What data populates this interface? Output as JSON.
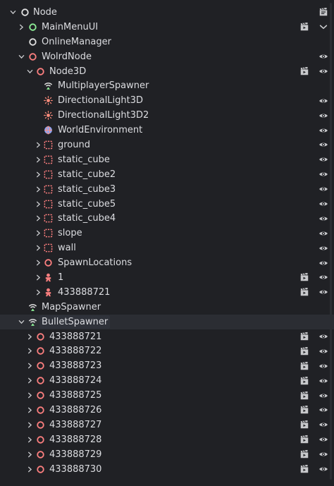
{
  "nodes": [
    {
      "label": "Node",
      "depth": 0,
      "arrow": "down",
      "icon": "white-circle-icon",
      "right": [
        "script-icon"
      ]
    },
    {
      "label": "MainMenuUI",
      "depth": 1,
      "arrow": "right",
      "icon": "green-circle-icon",
      "right": [
        "scene-icon",
        "visibility-toggle-icon"
      ]
    },
    {
      "label": "OnlineManager",
      "depth": 1,
      "arrow": "none",
      "icon": "white-circle-icon",
      "right": []
    },
    {
      "label": "WolrdNode",
      "depth": 1,
      "arrow": "down",
      "icon": "red-circle-icon",
      "right": [
        "eye-icon"
      ]
    },
    {
      "label": "Node3D",
      "depth": 2,
      "arrow": "down",
      "icon": "red-circle-icon",
      "right": [
        "scene-icon",
        "eye-icon"
      ]
    },
    {
      "label": "MultiplayerSpawner",
      "depth": 3,
      "arrow": "none",
      "icon": "spawner-icon",
      "right": []
    },
    {
      "label": "DirectionalLight3D",
      "depth": 3,
      "arrow": "none",
      "icon": "sun-icon",
      "right": [
        "eye-icon"
      ]
    },
    {
      "label": "DirectionalLight3D2",
      "depth": 3,
      "arrow": "none",
      "icon": "sun-icon",
      "right": [
        "eye-icon"
      ]
    },
    {
      "label": "WorldEnvironment",
      "depth": 3,
      "arrow": "none",
      "icon": "globe-icon",
      "right": [
        "eye-icon"
      ]
    },
    {
      "label": "ground",
      "depth": 3,
      "arrow": "right",
      "icon": "static-body-icon",
      "right": [
        "eye-icon"
      ]
    },
    {
      "label": "static_cube",
      "depth": 3,
      "arrow": "right",
      "icon": "static-body-icon",
      "right": [
        "eye-icon"
      ]
    },
    {
      "label": "static_cube2",
      "depth": 3,
      "arrow": "right",
      "icon": "static-body-icon",
      "right": [
        "eye-icon"
      ]
    },
    {
      "label": "static_cube3",
      "depth": 3,
      "arrow": "right",
      "icon": "static-body-icon",
      "right": [
        "eye-icon"
      ]
    },
    {
      "label": "static_cube5",
      "depth": 3,
      "arrow": "right",
      "icon": "static-body-icon",
      "right": [
        "eye-icon"
      ]
    },
    {
      "label": "static_cube4",
      "depth": 3,
      "arrow": "right",
      "icon": "static-body-icon",
      "right": [
        "eye-icon"
      ]
    },
    {
      "label": "slope",
      "depth": 3,
      "arrow": "right",
      "icon": "static-body-icon",
      "right": [
        "eye-icon"
      ]
    },
    {
      "label": "wall",
      "depth": 3,
      "arrow": "right",
      "icon": "static-body-icon",
      "right": [
        "eye-icon"
      ]
    },
    {
      "label": "SpawnLocations",
      "depth": 3,
      "arrow": "right",
      "icon": "red-circle-icon",
      "right": [
        "eye-icon"
      ]
    },
    {
      "label": "1",
      "depth": 3,
      "arrow": "right",
      "icon": "character-icon",
      "right": [
        "scene-icon",
        "eye-icon"
      ]
    },
    {
      "label": "433888721",
      "depth": 3,
      "arrow": "right",
      "icon": "character-icon",
      "right": [
        "scene-icon",
        "eye-icon"
      ]
    },
    {
      "label": "MapSpawner",
      "depth": 1,
      "arrow": "none",
      "icon": "spawner-icon",
      "right": []
    },
    {
      "label": "BulletSpawner",
      "depth": 1,
      "arrow": "down",
      "icon": "spawner-icon",
      "right": [],
      "selected": true
    },
    {
      "label": "433888721",
      "depth": 2,
      "arrow": "right",
      "icon": "red-circle-icon",
      "right": [
        "scene-icon",
        "eye-icon"
      ]
    },
    {
      "label": "433888722",
      "depth": 2,
      "arrow": "right",
      "icon": "red-circle-icon",
      "right": [
        "scene-icon",
        "eye-icon"
      ]
    },
    {
      "label": "433888723",
      "depth": 2,
      "arrow": "right",
      "icon": "red-circle-icon",
      "right": [
        "scene-icon",
        "eye-icon"
      ]
    },
    {
      "label": "433888724",
      "depth": 2,
      "arrow": "right",
      "icon": "red-circle-icon",
      "right": [
        "scene-icon",
        "eye-icon"
      ]
    },
    {
      "label": "433888725",
      "depth": 2,
      "arrow": "right",
      "icon": "red-circle-icon",
      "right": [
        "scene-icon",
        "eye-icon"
      ]
    },
    {
      "label": "433888726",
      "depth": 2,
      "arrow": "right",
      "icon": "red-circle-icon",
      "right": [
        "scene-icon",
        "eye-icon"
      ]
    },
    {
      "label": "433888727",
      "depth": 2,
      "arrow": "right",
      "icon": "red-circle-icon",
      "right": [
        "scene-icon",
        "eye-icon"
      ]
    },
    {
      "label": "433888728",
      "depth": 2,
      "arrow": "right",
      "icon": "red-circle-icon",
      "right": [
        "scene-icon",
        "eye-icon"
      ]
    },
    {
      "label": "433888729",
      "depth": 2,
      "arrow": "right",
      "icon": "red-circle-icon",
      "right": [
        "scene-icon",
        "eye-icon"
      ]
    },
    {
      "label": "433888730",
      "depth": 2,
      "arrow": "right",
      "icon": "red-circle-icon",
      "right": [
        "scene-icon",
        "eye-icon"
      ]
    }
  ],
  "colors": {
    "background": "#202125",
    "text": "#dcdde1",
    "node_white": "#e0e0e0",
    "node_green": "#8eef97",
    "node_red": "#fc7f7f",
    "icon_gray": "#c8c9cc",
    "sun_red": "#fc8c7c",
    "globe_blue": "#8da5f3"
  }
}
